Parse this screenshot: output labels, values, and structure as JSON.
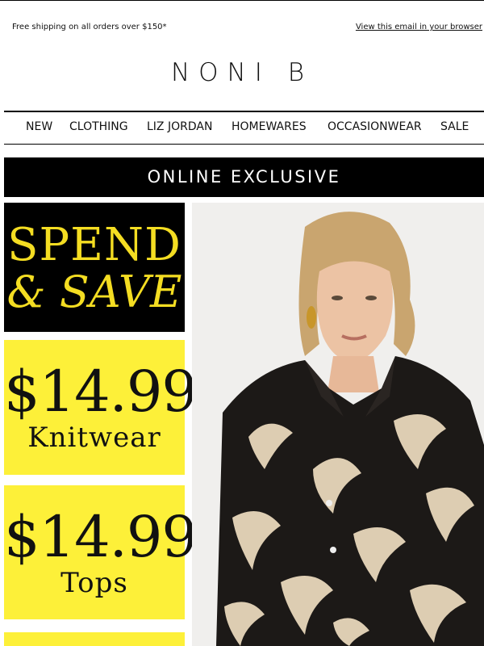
{
  "topbar": {
    "shipping_text": "Free shipping on all orders over $150*",
    "view_browser_text": "View this email in your browser"
  },
  "brand": {
    "logo_text": "NONI B"
  },
  "nav": {
    "items": [
      "NEW",
      "CLOTHING",
      "LIZ JORDAN",
      "HOMEWARES",
      "OCCASIONWEAR",
      "SALE"
    ]
  },
  "banner": {
    "text": "ONLINE EXCLUSIVE"
  },
  "promos": {
    "spend_line1": "SPEND",
    "spend_line2": "& SAVE",
    "knitwear_price": "$14.99",
    "knitwear_star": "*",
    "knitwear_label": "Knitwear",
    "tops_price": "$14.99",
    "tops_star": "*",
    "tops_label": "Tops"
  },
  "colors": {
    "promo_yellow": "#fdf039",
    "promo_text_yellow": "#f4dd22",
    "black": "#000000"
  }
}
